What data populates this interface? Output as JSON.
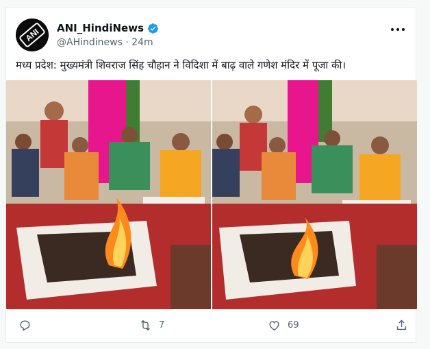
{
  "account": {
    "display_name": "ANI_HindiNews",
    "handle": "@AHindinews",
    "separator": "·",
    "time": "24m",
    "avatar_text": "ANI"
  },
  "tweet": {
    "text": "मध्य प्रदेश: मुख्यमंत्री शिवराज सिंह चौहान ने विदिशा में बाढ़ वाले गणेश मंदिर में पूजा की।"
  },
  "actions": {
    "reply_count": "",
    "retweet_count": "7",
    "like_count": "69"
  },
  "colors": {
    "verified": "#1d9bf0",
    "text": "#0f1419",
    "muted": "#536471",
    "fire": "#ff8a1c"
  },
  "icons": [
    "verified-icon",
    "more-icon",
    "reply-icon",
    "retweet-icon",
    "like-icon",
    "share-icon"
  ]
}
